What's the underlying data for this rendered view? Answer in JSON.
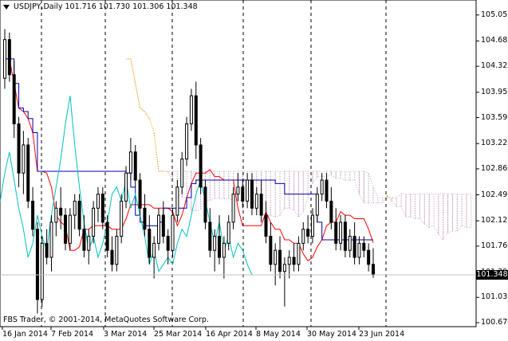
{
  "header": {
    "symbol": "USDJPY,Daily",
    "ohlc": "101.716 101.730 101.306 101.348"
  },
  "copyright": "FBS Trader, © 2001-2014, MetaQuotes Software Corp.",
  "current_price": "101.348",
  "colors": {
    "candle": "#000000",
    "tenkan": "#ff0000",
    "kijun": "#0000aa",
    "chikou": "#00c0c0",
    "kumo_up": "#e8a020",
    "kumo_down": "#c8a8c8",
    "grid": "#000000"
  },
  "chart_data": {
    "type": "candlestick",
    "symbol": "USDJPY",
    "timeframe": "Daily",
    "y_ticks": [
      "105.050",
      "104.680",
      "104.320",
      "103.950",
      "103.590",
      "103.220",
      "102.860",
      "102.490",
      "102.120",
      "101.760",
      "101.390",
      "101.030",
      "100.670"
    ],
    "x_ticks": [
      "16 Jan 2014",
      "7 Feb 2014",
      "3 Mar 2014",
      "25 Mar 2014",
      "16 Apr 2014",
      "8 May 2014",
      "30 May 2014",
      "23 Jun 2014"
    ],
    "ylim": [
      100.67,
      105.15
    ],
    "candles": [
      [
        104.15,
        104.85,
        104.0,
        104.7
      ],
      [
        104.7,
        104.8,
        104.1,
        104.2
      ],
      [
        104.2,
        104.4,
        103.3,
        103.5
      ],
      [
        103.5,
        103.6,
        102.6,
        102.8
      ],
      [
        102.8,
        103.4,
        102.5,
        103.2
      ],
      [
        103.2,
        103.3,
        102.3,
        102.4
      ],
      [
        102.4,
        102.6,
        101.9,
        102.0
      ],
      [
        102.0,
        102.1,
        100.8,
        101.0
      ],
      [
        101.0,
        101.9,
        100.9,
        101.8
      ],
      [
        101.8,
        102.0,
        101.5,
        101.6
      ],
      [
        101.6,
        102.2,
        101.4,
        102.1
      ],
      [
        102.1,
        102.4,
        101.9,
        102.3
      ],
      [
        102.3,
        102.6,
        102.0,
        102.2
      ],
      [
        102.2,
        102.3,
        101.7,
        101.8
      ],
      [
        101.8,
        102.3,
        101.7,
        102.2
      ],
      [
        102.2,
        102.5,
        102.0,
        102.4
      ],
      [
        102.4,
        102.5,
        101.9,
        102.0
      ],
      [
        102.0,
        102.2,
        101.6,
        101.7
      ],
      [
        101.7,
        102.0,
        101.5,
        101.9
      ],
      [
        101.9,
        102.4,
        101.8,
        102.3
      ],
      [
        102.3,
        102.6,
        102.1,
        102.5
      ],
      [
        102.5,
        102.6,
        102.0,
        102.1
      ],
      [
        102.1,
        102.2,
        101.6,
        101.7
      ],
      [
        101.7,
        101.9,
        101.4,
        101.5
      ],
      [
        101.5,
        102.0,
        101.4,
        101.9
      ],
      [
        101.9,
        102.5,
        101.8,
        102.4
      ],
      [
        102.4,
        102.9,
        102.3,
        102.8
      ],
      [
        102.8,
        103.3,
        102.7,
        103.1
      ],
      [
        103.1,
        103.2,
        102.6,
        102.7
      ],
      [
        102.7,
        102.8,
        102.2,
        102.3
      ],
      [
        102.3,
        102.5,
        101.9,
        102.0
      ],
      [
        102.0,
        102.2,
        101.5,
        101.6
      ],
      [
        101.6,
        101.9,
        101.3,
        101.8
      ],
      [
        101.8,
        102.3,
        101.7,
        102.2
      ],
      [
        102.2,
        102.4,
        101.8,
        101.9
      ],
      [
        101.9,
        102.0,
        101.5,
        101.7
      ],
      [
        101.7,
        102.3,
        101.6,
        102.2
      ],
      [
        102.2,
        102.7,
        102.1,
        102.6
      ],
      [
        102.6,
        103.1,
        102.5,
        103.0
      ],
      [
        103.0,
        103.6,
        102.9,
        103.5
      ],
      [
        103.5,
        104.0,
        103.4,
        103.9
      ],
      [
        103.9,
        104.1,
        103.0,
        103.2
      ],
      [
        103.2,
        103.3,
        102.5,
        102.6
      ],
      [
        102.6,
        102.7,
        102.0,
        102.1
      ],
      [
        102.1,
        102.3,
        101.6,
        101.7
      ],
      [
        101.7,
        102.0,
        101.4,
        101.9
      ],
      [
        101.9,
        102.2,
        101.5,
        101.6
      ],
      [
        101.6,
        101.9,
        101.3,
        101.8
      ],
      [
        101.8,
        102.2,
        101.7,
        102.1
      ],
      [
        102.1,
        102.6,
        102.0,
        102.5
      ],
      [
        102.5,
        102.8,
        102.4,
        102.6
      ],
      [
        102.6,
        102.7,
        102.3,
        102.4
      ],
      [
        102.4,
        102.8,
        102.3,
        102.7
      ],
      [
        102.7,
        102.8,
        102.2,
        102.3
      ],
      [
        102.3,
        102.6,
        102.2,
        102.5
      ],
      [
        102.5,
        102.7,
        102.1,
        102.2
      ],
      [
        102.2,
        102.4,
        101.8,
        101.9
      ],
      [
        101.9,
        102.1,
        101.4,
        101.5
      ],
      [
        101.5,
        101.8,
        101.2,
        101.7
      ],
      [
        101.7,
        101.9,
        101.3,
        101.4
      ],
      [
        101.4,
        101.6,
        100.9,
        101.5
      ],
      [
        101.5,
        101.7,
        101.3,
        101.6
      ],
      [
        101.6,
        101.8,
        101.4,
        101.5
      ],
      [
        101.5,
        101.9,
        101.4,
        101.8
      ],
      [
        101.8,
        102.1,
        101.7,
        102.0
      ],
      [
        102.0,
        102.2,
        101.8,
        101.9
      ],
      [
        101.9,
        102.3,
        101.8,
        102.2
      ],
      [
        102.2,
        102.6,
        102.1,
        102.5
      ],
      [
        102.5,
        102.8,
        102.4,
        102.7
      ],
      [
        102.7,
        102.8,
        102.3,
        102.4
      ],
      [
        102.4,
        102.6,
        102.0,
        102.1
      ],
      [
        102.1,
        102.3,
        101.7,
        101.8
      ],
      [
        101.8,
        102.2,
        101.7,
        102.1
      ],
      [
        102.1,
        102.2,
        101.6,
        101.7
      ],
      [
        101.7,
        102.0,
        101.6,
        101.9
      ],
      [
        101.9,
        102.1,
        101.5,
        101.6
      ],
      [
        101.6,
        101.9,
        101.5,
        101.8
      ],
      [
        101.8,
        101.9,
        101.6,
        101.7
      ],
      [
        101.7,
        101.8,
        101.4,
        101.5
      ],
      [
        101.5,
        101.73,
        101.31,
        101.35
      ]
    ]
  }
}
